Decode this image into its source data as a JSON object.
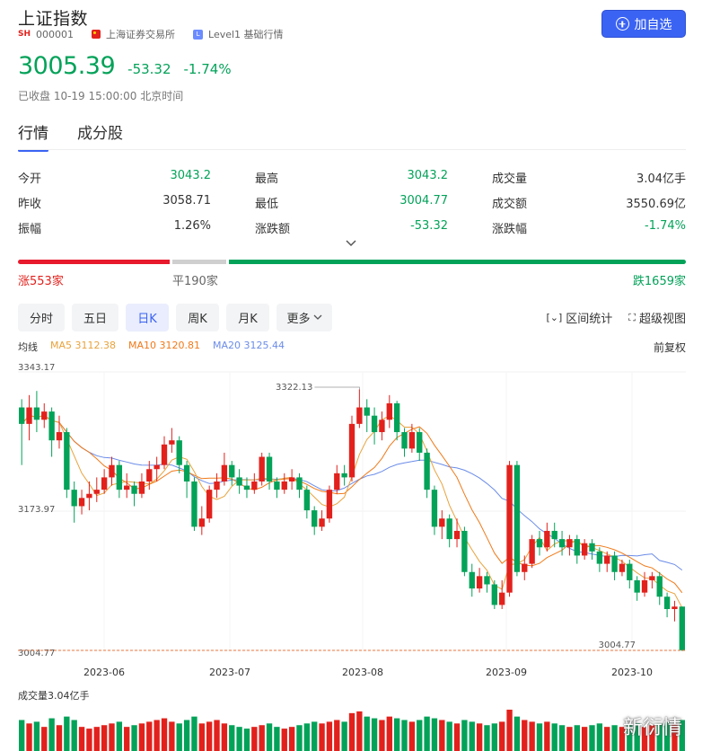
{
  "header": {
    "title": "上证指数",
    "market_badge": "SH",
    "code": "000001",
    "exchange": "上海证券交易所",
    "level_badge": "L",
    "level": "Level1 基础行情",
    "add_button": "加自选"
  },
  "quote": {
    "price": "3005.39",
    "change": "-53.32",
    "change_pct": "-1.74%",
    "status": "已收盘 10-19 15:00:00 北京时间"
  },
  "tabs": [
    "行情",
    "成分股"
  ],
  "stats": [
    [
      {
        "label": "今开",
        "value": "3043.2",
        "color": "green"
      },
      {
        "label": "最高",
        "value": "3043.2",
        "color": "green"
      },
      {
        "label": "成交量",
        "value": "3.04亿手",
        "color": "normal"
      }
    ],
    [
      {
        "label": "昨收",
        "value": "3058.71",
        "color": "normal"
      },
      {
        "label": "最低",
        "value": "3004.77",
        "color": "green"
      },
      {
        "label": "成交额",
        "value": "3550.69亿",
        "color": "normal"
      }
    ],
    [
      {
        "label": "振幅",
        "value": "1.26%",
        "color": "normal"
      },
      {
        "label": "涨跌额",
        "value": "-53.32",
        "color": "green"
      },
      {
        "label": "涨跌幅",
        "value": "-1.74%",
        "color": "green"
      }
    ]
  ],
  "breadth": {
    "up_label": "涨553家",
    "flat_label": "平190家",
    "down_label": "跌1659家",
    "up": 553,
    "flat": 190,
    "down": 1659
  },
  "periods": [
    {
      "label": "分时",
      "active": false
    },
    {
      "label": "五日",
      "active": false
    },
    {
      "label": "日K",
      "active": true
    },
    {
      "label": "周K",
      "active": false
    },
    {
      "label": "月K",
      "active": false
    },
    {
      "label": "更多",
      "active": false
    }
  ],
  "tools": {
    "range_stats": "区间统计",
    "super_view": "超级视图",
    "adjust": "前复权"
  },
  "ma": {
    "label": "均线",
    "ma5": "MA5 3112.38",
    "ma10": "MA10 3120.81",
    "ma20": "MA20 3125.44"
  },
  "colors": {
    "up": "#e2211c",
    "down": "#03a259",
    "ma5": "#e8a33c",
    "ma10": "#f07a1a",
    "ma20": "#6b8ce8",
    "accent": "#3b63f3"
  },
  "volume_title": "成交量3.04亿手",
  "watermark": "新衍情",
  "chart_data": {
    "type": "candlestick",
    "y_ticks": [
      "3343.17",
      "3173.97",
      "3004.77"
    ],
    "ylim": [
      3004.77,
      3343.17
    ],
    "x_ticks": [
      "2023-06",
      "2023-07",
      "2023-08",
      "2023-09",
      "2023-10"
    ],
    "annotations": {
      "high": "3322.13",
      "low": "3004.77"
    },
    "candles": [
      [
        3300,
        3280,
        3310,
        3230
      ],
      [
        3280,
        3300,
        3315,
        3260
      ],
      [
        3300,
        3285,
        3320,
        3270
      ],
      [
        3285,
        3295,
        3305,
        3275
      ],
      [
        3295,
        3260,
        3300,
        3240
      ],
      [
        3260,
        3270,
        3290,
        3250
      ],
      [
        3270,
        3200,
        3275,
        3190
      ],
      [
        3200,
        3180,
        3210,
        3160
      ],
      [
        3180,
        3190,
        3200,
        3170
      ],
      [
        3190,
        3195,
        3210,
        3175
      ],
      [
        3195,
        3200,
        3215,
        3185
      ],
      [
        3200,
        3215,
        3225,
        3195
      ],
      [
        3215,
        3230,
        3240,
        3205
      ],
      [
        3230,
        3200,
        3235,
        3190
      ],
      [
        3200,
        3205,
        3220,
        3190
      ],
      [
        3205,
        3195,
        3210,
        3180
      ],
      [
        3195,
        3210,
        3220,
        3190
      ],
      [
        3210,
        3225,
        3235,
        3200
      ],
      [
        3225,
        3230,
        3240,
        3210
      ],
      [
        3230,
        3255,
        3265,
        3225
      ],
      [
        3255,
        3260,
        3275,
        3245
      ],
      [
        3260,
        3230,
        3265,
        3220
      ],
      [
        3230,
        3210,
        3235,
        3190
      ],
      [
        3210,
        3155,
        3215,
        3150
      ],
      [
        3155,
        3165,
        3180,
        3145
      ],
      [
        3165,
        3200,
        3205,
        3160
      ],
      [
        3200,
        3210,
        3220,
        3190
      ],
      [
        3210,
        3230,
        3245,
        3205
      ],
      [
        3230,
        3215,
        3235,
        3205
      ],
      [
        3215,
        3205,
        3225,
        3195
      ],
      [
        3205,
        3200,
        3215,
        3190
      ],
      [
        3200,
        3210,
        3220,
        3195
      ],
      [
        3210,
        3240,
        3245,
        3205
      ],
      [
        3240,
        3210,
        3245,
        3200
      ],
      [
        3210,
        3200,
        3215,
        3190
      ],
      [
        3200,
        3210,
        3220,
        3195
      ],
      [
        3210,
        3215,
        3225,
        3200
      ],
      [
        3215,
        3200,
        3220,
        3190
      ],
      [
        3200,
        3175,
        3205,
        3165
      ],
      [
        3175,
        3155,
        3180,
        3145
      ],
      [
        3155,
        3165,
        3175,
        3150
      ],
      [
        3165,
        3200,
        3205,
        3160
      ],
      [
        3200,
        3220,
        3230,
        3195
      ],
      [
        3220,
        3215,
        3230,
        3205
      ],
      [
        3215,
        3280,
        3290,
        3210
      ],
      [
        3280,
        3300,
        3322,
        3275
      ],
      [
        3300,
        3290,
        3310,
        3270
      ],
      [
        3290,
        3270,
        3300,
        3255
      ],
      [
        3270,
        3285,
        3295,
        3260
      ],
      [
        3285,
        3305,
        3315,
        3275
      ],
      [
        3305,
        3270,
        3308,
        3260
      ],
      [
        3270,
        3250,
        3275,
        3240
      ],
      [
        3250,
        3270,
        3280,
        3245
      ],
      [
        3270,
        3245,
        3275,
        3235
      ],
      [
        3245,
        3200,
        3250,
        3190
      ],
      [
        3200,
        3155,
        3205,
        3145
      ],
      [
        3155,
        3165,
        3175,
        3140
      ],
      [
        3165,
        3140,
        3170,
        3130
      ],
      [
        3140,
        3150,
        3165,
        3130
      ],
      [
        3150,
        3100,
        3155,
        3095
      ],
      [
        3100,
        3080,
        3110,
        3070
      ],
      [
        3080,
        3095,
        3105,
        3075
      ],
      [
        3095,
        3085,
        3100,
        3075
      ],
      [
        3085,
        3060,
        3090,
        3055
      ],
      [
        3060,
        3075,
        3090,
        3055
      ],
      [
        3075,
        3230,
        3235,
        3070
      ],
      [
        3230,
        3100,
        3235,
        3095
      ],
      [
        3100,
        3110,
        3120,
        3090
      ],
      [
        3110,
        3140,
        3145,
        3105
      ],
      [
        3140,
        3130,
        3150,
        3120
      ],
      [
        3130,
        3150,
        3160,
        3125
      ],
      [
        3150,
        3140,
        3160,
        3130
      ],
      [
        3140,
        3130,
        3150,
        3120
      ],
      [
        3130,
        3140,
        3145,
        3120
      ],
      [
        3140,
        3120,
        3145,
        3110
      ],
      [
        3120,
        3135,
        3140,
        3115
      ],
      [
        3135,
        3125,
        3140,
        3115
      ],
      [
        3125,
        3110,
        3130,
        3100
      ],
      [
        3110,
        3120,
        3125,
        3100
      ],
      [
        3120,
        3100,
        3125,
        3090
      ],
      [
        3100,
        3110,
        3115,
        3095
      ],
      [
        3110,
        3090,
        3115,
        3080
      ],
      [
        3090,
        3075,
        3095,
        3065
      ],
      [
        3075,
        3090,
        3100,
        3070
      ],
      [
        3090,
        3095,
        3100,
        3080
      ],
      [
        3095,
        3070,
        3100,
        3060
      ],
      [
        3070,
        3055,
        3075,
        3045
      ],
      [
        3055,
        3058,
        3065,
        3040
      ],
      [
        3058,
        3005,
        3043,
        3004
      ]
    ],
    "volumes": [
      0.9,
      0.8,
      0.85,
      0.7,
      0.95,
      0.75,
      1.0,
      0.9,
      0.7,
      0.65,
      0.7,
      0.75,
      0.8,
      0.85,
      0.7,
      0.75,
      0.8,
      0.85,
      0.9,
      0.95,
      0.85,
      0.8,
      0.9,
      1.0,
      0.8,
      0.85,
      0.9,
      0.8,
      0.75,
      0.7,
      0.65,
      0.7,
      0.75,
      0.8,
      0.7,
      0.65,
      0.7,
      0.75,
      0.8,
      0.85,
      0.8,
      0.85,
      0.9,
      0.85,
      1.1,
      1.15,
      1.0,
      0.95,
      0.9,
      1.0,
      0.95,
      0.9,
      0.85,
      0.9,
      1.0,
      0.95,
      0.9,
      0.85,
      0.8,
      0.9,
      0.85,
      0.8,
      0.75,
      0.8,
      0.85,
      1.2,
      1.0,
      0.9,
      0.85,
      0.8,
      0.85,
      0.8,
      0.75,
      0.7,
      0.75,
      0.7,
      0.75,
      0.8,
      0.7,
      0.75,
      0.7,
      0.75,
      0.8,
      0.7,
      0.75,
      0.8,
      0.85,
      0.8,
      0.9
    ]
  }
}
